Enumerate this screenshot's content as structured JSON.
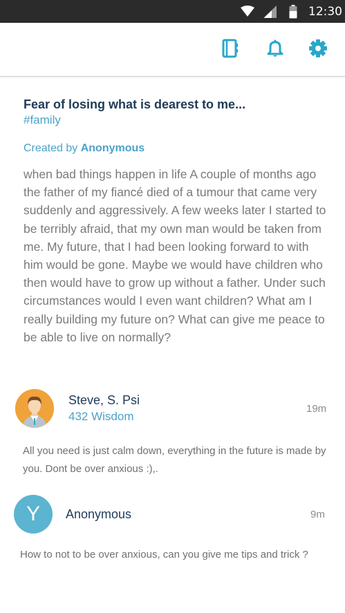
{
  "status_bar": {
    "time": "12:30"
  },
  "toolbar": {
    "icons": [
      "journal-icon",
      "bell-icon",
      "gear-icon"
    ],
    "accent": "#29a7c9"
  },
  "post": {
    "title": "Fear of losing what is dearest to me...",
    "tag": "#family",
    "created_by_prefix": "Created by",
    "author": "Anonymous",
    "body": "when bad things happen in life  A couple of months ago the father of my fiancé died of a tumour that came very suddenly and aggressively. A few weeks later I started to be terribly afraid, that my own man would be taken from me. My future, that I had been looking forward to with him would be gone. Maybe we would have children who then would have to grow up without a father. Under such circumstances would I even want children? What am I really building my future on? What can give me peace to be able to live on normally?"
  },
  "comments": [
    {
      "name": "Steve, S. Psi",
      "wisdom": "432 Wisdom",
      "time": "19m",
      "text": "All you need is just calm down, everything in the future is made by you. Dont be over anxious :),."
    },
    {
      "avatar_letter": "Y",
      "name": "Anonymous",
      "time": "9m",
      "text": "How to not to be over anxious, can you give me tips and trick ?"
    }
  ],
  "colors": {
    "title": "#1f3b57",
    "link": "#4aa3c8",
    "body": "#7a7a7a",
    "avatar_orange": "#f0a23b",
    "avatar_blue": "#5bb4d0"
  }
}
